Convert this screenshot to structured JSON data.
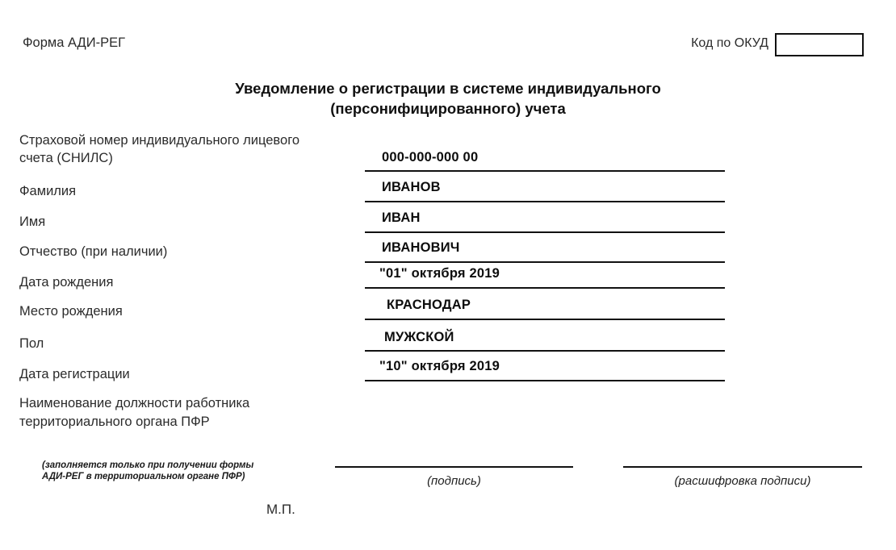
{
  "header": {
    "form_code": "Форма АДИ-РЕГ",
    "okud_label": "Код по ОКУД",
    "okud_value": ""
  },
  "title": {
    "line1": "Уведомление о регистрации в системе индивидуального",
    "line2": "(персонифицированного) учета"
  },
  "fields": [
    {
      "label": "Страховой номер индивидуального лицевого\nсчета (СНИЛС)",
      "value": "000-000-000 00"
    },
    {
      "label": "Фамилия",
      "value": "ИВАНОВ"
    },
    {
      "label": "Имя",
      "value": "ИВАН"
    },
    {
      "label": "Отчество (при наличии)",
      "value": "ИВАНОВИЧ"
    },
    {
      "label": "Дата рождения",
      "value": "\"01\" октября   2019"
    },
    {
      "label": "Место рождения",
      "value": "КРАСНОДАР"
    },
    {
      "label": "Пол",
      "value": "МУЖСКОЙ"
    },
    {
      "label": "Дата регистрации",
      "value": "\"10\" октября   2019"
    }
  ],
  "position_block": {
    "text": "Наименование должности работника\nтерриториального органа ПФР"
  },
  "footer": {
    "note": "(заполняется только при получении формы\nАДИ-РЕГ в территориальном органе ПФР)",
    "signature_caption": "(подпись)",
    "transcript_caption": "(расшифровка подписи)",
    "stamp_mark": "М.П."
  }
}
